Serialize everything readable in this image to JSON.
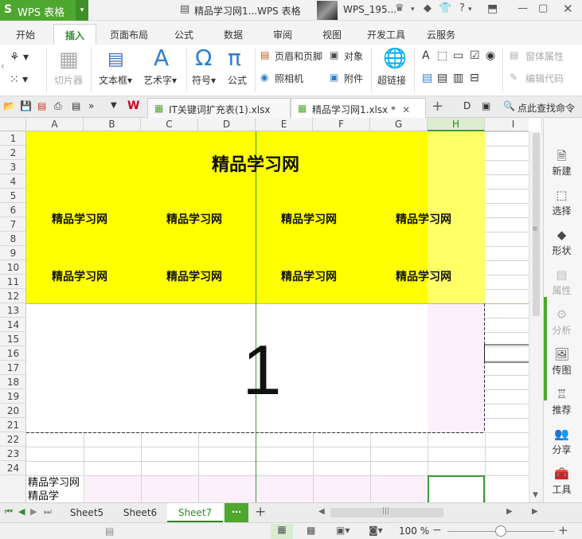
{
  "titlebar": {
    "app_name": "WPS 表格",
    "doc_title": "精品学习网1...WPS 表格",
    "user": "WPS_195..."
  },
  "menu": {
    "tabs": [
      "开始",
      "插入",
      "页面布局",
      "公式",
      "数据",
      "审阅",
      "视图",
      "开发工具",
      "云服务"
    ],
    "active": "插入"
  },
  "ribbon": {
    "slicer": "切片器",
    "textbox": "文本框",
    "wordart": "艺术字",
    "symbol": "符号",
    "formula": "公式",
    "header_footer": "页眉和页脚",
    "object": "对象",
    "camera": "照相机",
    "attachment": "附件",
    "hyperlink": "超链接",
    "form_props": "窗体属性",
    "edit_code": "编辑代码"
  },
  "doc_tabs": [
    {
      "label": "IT关键词扩充表(1).xlsx *",
      "active": false
    },
    {
      "label": "精品学习网1.xlsx *",
      "active": true
    }
  ],
  "search_cmd": "点此查找命令",
  "columns": [
    "A",
    "B",
    "C",
    "D",
    "E",
    "F",
    "G",
    "H",
    "I"
  ],
  "selected_column": "H",
  "rows": [
    "1",
    "2",
    "3",
    "4",
    "5",
    "6",
    "7",
    "8",
    "9",
    "10",
    "11",
    "12",
    "13",
    "14",
    "15",
    "16",
    "17",
    "18",
    "19",
    "20",
    "21",
    "22",
    "23",
    "24"
  ],
  "sheet": {
    "banner_title": "精品学习网",
    "grid_label": "精品学习网",
    "big_number": "1",
    "cell_a25": "精品学习网精品学",
    "highlight_color": "#ffff00",
    "pink_color": "#fdf0fb"
  },
  "side_panel": [
    {
      "label": "新建",
      "icon": "new-doc-icon",
      "enabled": true
    },
    {
      "label": "选择",
      "icon": "select-icon",
      "enabled": true
    },
    {
      "label": "形状",
      "icon": "shape-icon",
      "enabled": true
    },
    {
      "label": "属性",
      "icon": "properties-icon",
      "enabled": false
    },
    {
      "label": "分析",
      "icon": "analysis-icon",
      "enabled": false
    },
    {
      "label": "传图",
      "icon": "upload-image-icon",
      "enabled": true
    },
    {
      "label": "推荐",
      "icon": "recommend-icon",
      "enabled": true
    },
    {
      "label": "分享",
      "icon": "share-icon",
      "enabled": true
    },
    {
      "label": "工具",
      "icon": "toolbox-icon",
      "enabled": true
    }
  ],
  "sheet_tabs": [
    "Sheet5",
    "Sheet6",
    "Sheet7"
  ],
  "active_sheet": "Sheet7",
  "status": {
    "zoom": "100 %"
  }
}
